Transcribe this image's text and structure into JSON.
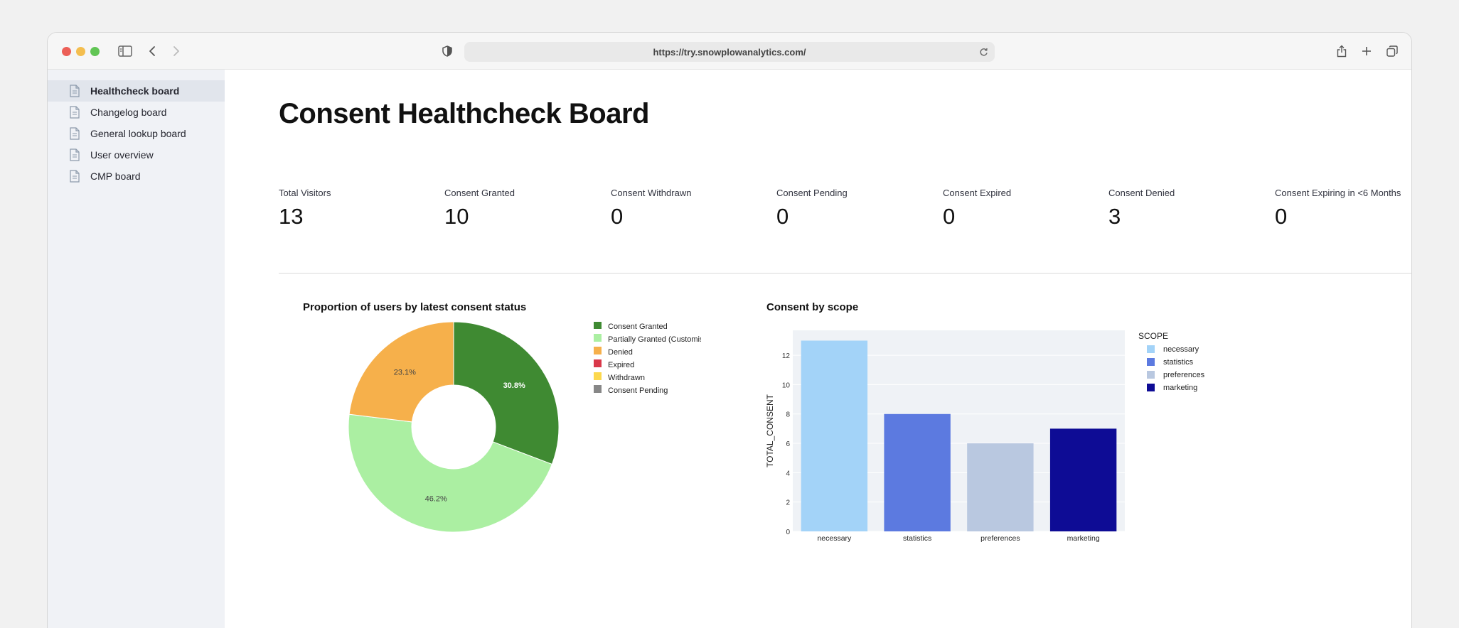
{
  "browser": {
    "url": "https://try.snowplowanalytics.com/"
  },
  "sidebar": {
    "items": [
      {
        "label": "Healthcheck board"
      },
      {
        "label": "Changelog board"
      },
      {
        "label": "General lookup board"
      },
      {
        "label": "User overview"
      },
      {
        "label": "CMP board"
      }
    ]
  },
  "page": {
    "title": "Consent Healthcheck Board"
  },
  "metrics": [
    {
      "label": "Total Visitors",
      "value": "13"
    },
    {
      "label": "Consent Granted",
      "value": "10"
    },
    {
      "label": "Consent Withdrawn",
      "value": "0"
    },
    {
      "label": "Consent Pending",
      "value": "0"
    },
    {
      "label": "Consent Expired",
      "value": "0"
    },
    {
      "label": "Consent Denied",
      "value": "3"
    },
    {
      "label": "Consent Expiring in <6 Months",
      "value": "0"
    }
  ],
  "chart_data": [
    {
      "type": "pie",
      "title": "Proportion of users by latest consent status",
      "hole": true,
      "slices": [
        {
          "name": "Consent Granted",
          "value": 30.8,
          "label": "30.8%",
          "color": "#3f8a32"
        },
        {
          "name": "Partially Granted (Customised)",
          "value": 46.2,
          "label": "46.2%",
          "color": "#abefa2"
        },
        {
          "name": "Denied",
          "value": 23.1,
          "label": "23.1%",
          "color": "#f6b04b"
        },
        {
          "name": "Expired",
          "value": 0,
          "label": "",
          "color": "#d9384a"
        },
        {
          "name": "Withdrawn",
          "value": 0,
          "label": "",
          "color": "#fcd84e"
        },
        {
          "name": "Consent Pending",
          "value": 0,
          "label": "",
          "color": "#878787"
        }
      ],
      "legend": "right"
    },
    {
      "type": "bar",
      "title": "Consent by scope",
      "categories": [
        "necessary",
        "statistics",
        "preferences",
        "marketing"
      ],
      "values": [
        13,
        8,
        6,
        7
      ],
      "colors": [
        "#a3d3f8",
        "#5c7ae0",
        "#b9c8e0",
        "#0e0c95"
      ],
      "xlabel": "SCOPE",
      "ylabel": "TOTAL_CONSENT",
      "ylim": [
        0,
        13.7
      ],
      "yticks": [
        0,
        2,
        4,
        6,
        8,
        10,
        12
      ],
      "legend_title": "SCOPE",
      "legend": "right",
      "grid": true
    }
  ]
}
